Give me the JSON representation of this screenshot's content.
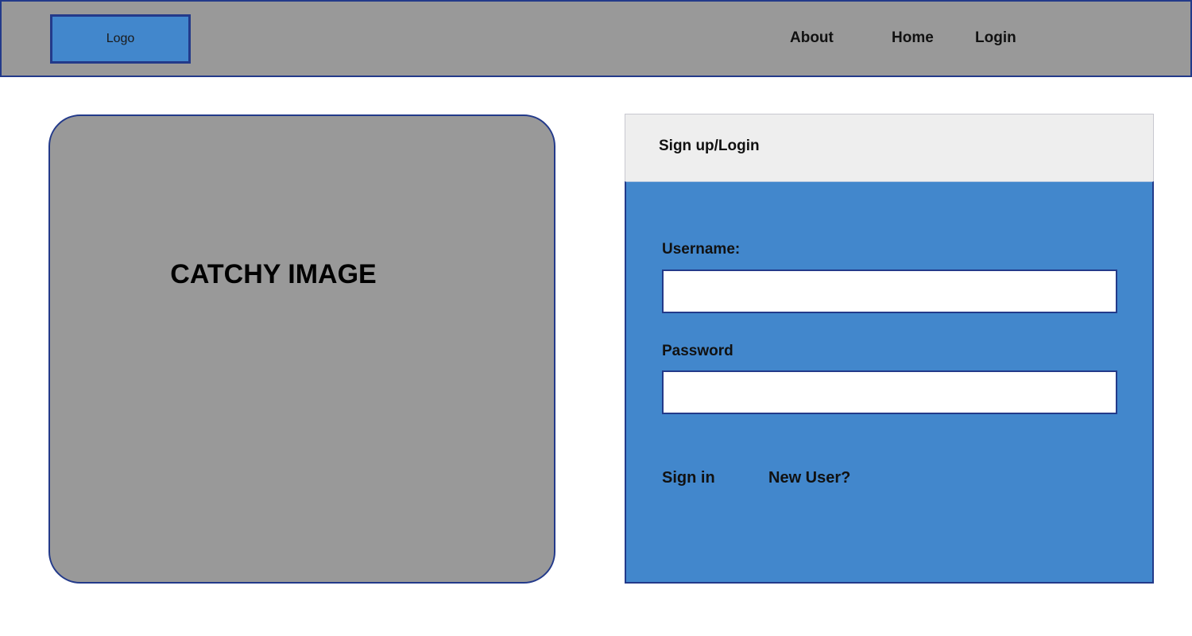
{
  "header": {
    "logo": "Logo",
    "nav": [
      {
        "label": "About"
      },
      {
        "label": "Home"
      },
      {
        "label": "Login"
      }
    ]
  },
  "hero": {
    "text": "CATCHY IMAGE"
  },
  "login": {
    "title": "Sign up/Login",
    "username_label": "Username:",
    "username_value": "",
    "password_label": "Password",
    "password_value": "",
    "sign_in": "Sign in",
    "new_user": "New User?"
  },
  "colors": {
    "header_bg": "#999999",
    "accent_blue": "#4287cc",
    "border_navy": "#233a8a",
    "panel_header_bg": "#eeeeee"
  }
}
